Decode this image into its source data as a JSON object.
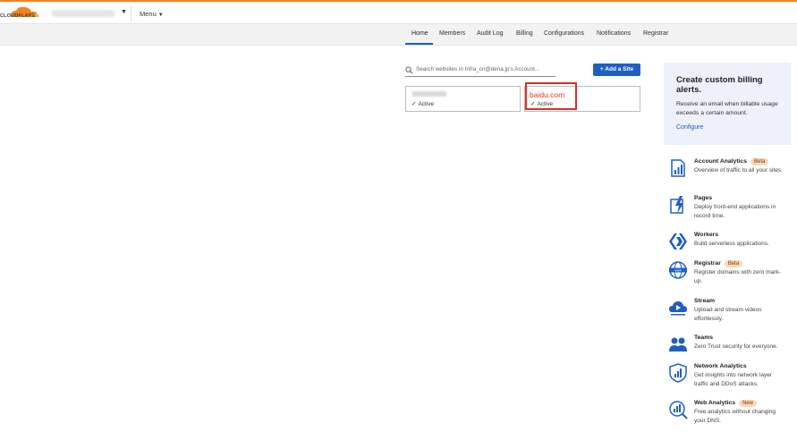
{
  "header": {
    "logo_text": "CLOUDFLARE",
    "menu_label": "Menu",
    "brand_color": "#f6821f",
    "accent_color": "#1f5fc4"
  },
  "nav": {
    "tabs": [
      "Home",
      "Members",
      "Audit Log",
      "Billing",
      "Configurations",
      "Notifications",
      "Registrar"
    ],
    "active": "Home"
  },
  "search": {
    "placeholder": "Search websites in Infra_cn@dena.jp's Account..."
  },
  "add_site_label": "+ Add a Site",
  "sites": [
    {
      "name": "",
      "status": "Active"
    },
    {
      "name": "baidu.com",
      "status": "Active"
    }
  ],
  "billing": {
    "title": "Create custom billing alerts.",
    "description": "Receive an email when billable usage exceeds a certain amount.",
    "link": "Configure"
  },
  "products": [
    {
      "title": "Account Analytics",
      "badge": "Beta",
      "description": "Overview of traffic to all your sites.",
      "icon": "analytics-icon"
    },
    {
      "title": "Pages",
      "badge": "",
      "description": "Deploy front-end applications in record time.",
      "icon": "pages-icon"
    },
    {
      "title": "Workers",
      "badge": "",
      "description": "Build serverless applications.",
      "icon": "workers-icon"
    },
    {
      "title": "Registrar",
      "badge": "Beta",
      "description": "Register domains with zero mark-up.",
      "icon": "registrar-globe-icon"
    },
    {
      "title": "Stream",
      "badge": "",
      "description": "Upload and stream videos effortlessly.",
      "icon": "stream-cloud-icon"
    },
    {
      "title": "Teams",
      "badge": "",
      "description": "Zero Trust security for everyone.",
      "icon": "teams-icon"
    },
    {
      "title": "Network Analytics",
      "badge": "",
      "description": "Get insights into network layer traffic and DDoS attacks.",
      "icon": "network-shield-icon"
    },
    {
      "title": "Web Analytics",
      "badge": "New",
      "description": "Free analytics without changing your DNS.",
      "icon": "web-analytics-icon"
    }
  ]
}
